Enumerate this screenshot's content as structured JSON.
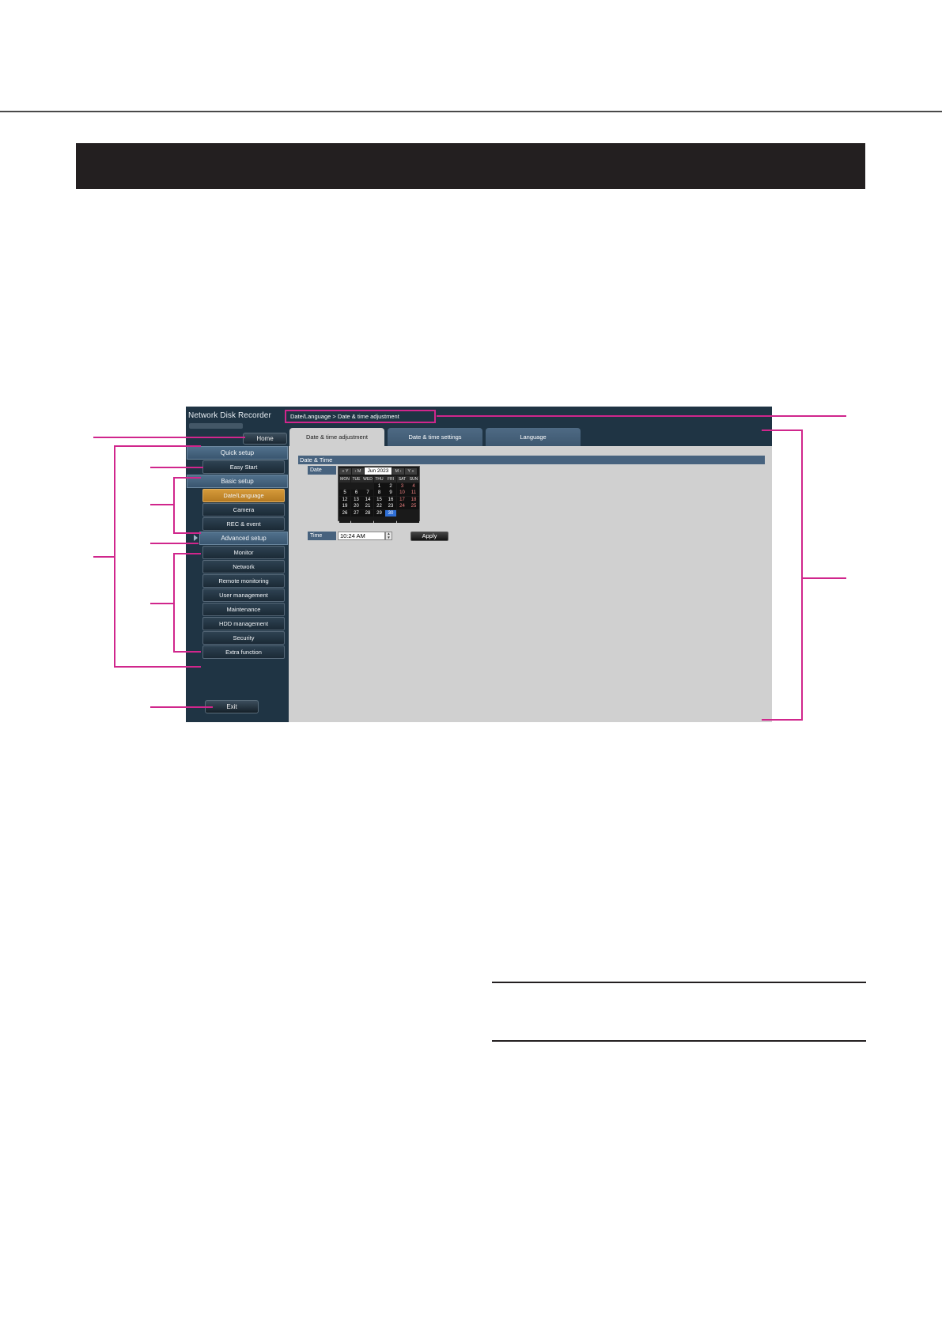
{
  "screen": {
    "app_title": "Network Disk Recorder",
    "breadcrumb": "Date/Language > Date & time adjustment",
    "home_label": "Home",
    "exit_label": "Exit",
    "nav": {
      "quick_setup": "Quick setup",
      "easy_start": "Easy Start",
      "basic_setup": "Basic setup",
      "date_language": "Date/Language",
      "camera": "Camera",
      "rec_event": "REC & event",
      "advanced_setup": "Advanced setup",
      "monitor": "Monitor",
      "network": "Network",
      "remote_monitoring": "Remote monitoring",
      "user_management": "User management",
      "maintenance": "Maintenance",
      "hdd_management": "HDD management",
      "security": "Security",
      "extra_function": "Extra function"
    },
    "tabs": [
      "Date & time adjustment",
      "Date & time settings",
      "Language"
    ],
    "section_title": "Date & Time",
    "date_label": "Date",
    "time_label": "Time",
    "time_value": "10:24 AM",
    "apply_label": "Apply",
    "calendar": {
      "nav_prev_year": "« Y",
      "nav_prev_month": "‹ M",
      "month_label": "Jun 2023",
      "nav_next_month": "M ›",
      "nav_next_year": "Y »",
      "headers": [
        "MON",
        "TUE",
        "WED",
        "THU",
        "FRI",
        "SAT",
        "SUN"
      ],
      "days": [
        "",
        "",
        "",
        "1",
        "2",
        "3",
        "4",
        "5",
        "6",
        "7",
        "8",
        "9",
        "10",
        "11",
        "12",
        "13",
        "14",
        "15",
        "16",
        "17",
        "18",
        "19",
        "20",
        "21",
        "22",
        "23",
        "24",
        "25",
        "26",
        "27",
        "28",
        "29",
        "30",
        "",
        "",
        "",
        "",
        "",
        "",
        "",
        "",
        ""
      ],
      "selected_day": "30"
    }
  },
  "colors": {
    "header_band": "#231f20",
    "callout": "#d0268c",
    "active_nav": "#c98a2e",
    "panel_bg": "#1f3444",
    "content_bg": "#d0d0d0"
  }
}
